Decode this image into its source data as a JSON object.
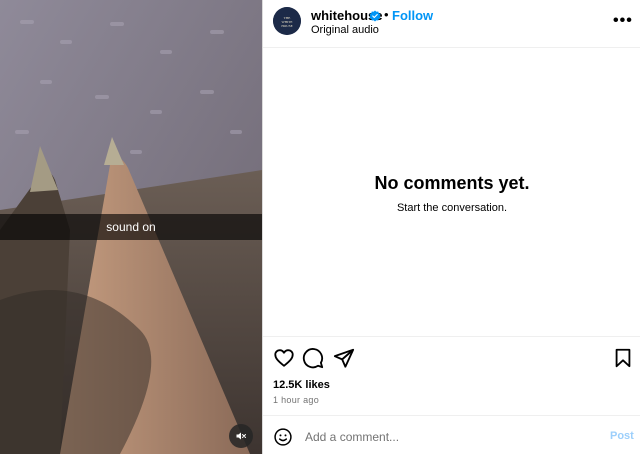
{
  "media": {
    "caption": "sound on",
    "mute_icon": "speaker-muted-icon"
  },
  "post": {
    "author": {
      "username": "whitehouse",
      "verified": true,
      "avatar_text": "THE WHITE HOUSE"
    },
    "separator": "•",
    "follow_label": "Follow",
    "audio_label": "Original audio",
    "more_label": "•••"
  },
  "comments": {
    "empty_title": "No comments yet.",
    "empty_subtitle": "Start the conversation."
  },
  "actions": {
    "icons": [
      "heart-icon",
      "comment-icon",
      "share-icon",
      "bookmark-icon"
    ]
  },
  "stats": {
    "likes": "12.5K likes",
    "time": "1 hour ago"
  },
  "composer": {
    "placeholder": "Add a comment...",
    "post_label": "Post",
    "emoji_icon": "emoji-icon"
  },
  "colors": {
    "accent": "#0095f6",
    "post_disabled": "#9ccffb",
    "muted_text": "#737373"
  }
}
